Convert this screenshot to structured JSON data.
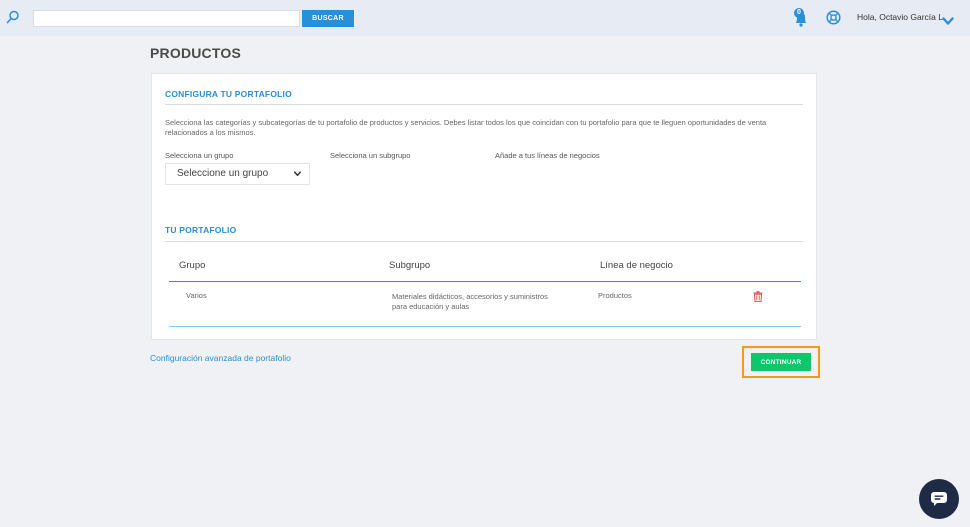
{
  "header": {
    "search_value": "",
    "search_button": "BUSCAR",
    "notifications_count": "0",
    "user_greeting": "Hola, Octavio García L",
    "icons": [
      "search-icon",
      "bell-icon",
      "help-icon",
      "chevron-down-icon"
    ]
  },
  "page": {
    "title": "PRODUCTOS"
  },
  "config": {
    "title": "CONFIGURA TU PORTAFOLIO",
    "description": "Selecciona las categorías y subcategorías de tu portafolio de productos y servicios. Debes listar todos los que coincidan con tu portafolio para que te lleguen oportunidades de venta relacionados a los mismos.",
    "group_label": "Selecciona un grupo",
    "subgroup_label": "Selecciona un subgrupo",
    "business_label": "Añade a tus líneas de negocios",
    "group_select_value": "Seleccione un grupo"
  },
  "portfolio": {
    "title": "TU PORTAFOLIO",
    "columns": [
      "Grupo",
      "Subgrupo",
      "Línea de negocio"
    ],
    "rows": [
      {
        "grupo": "Varios",
        "subgrupo_line1": "Materiales didácticos, accesorios y suministros",
        "subgrupo_line2": "para educación y aulas",
        "linea": "Productos"
      }
    ]
  },
  "footer": {
    "advanced_link": "Configuración avanzada de portafolio",
    "continue_button": "CONTINUAR"
  },
  "colors": {
    "accent": "#2a8fd6",
    "continue": "#10c66b",
    "highlight": "#f39a1e",
    "delete": "#e05252",
    "chat": "#1f2a44"
  }
}
